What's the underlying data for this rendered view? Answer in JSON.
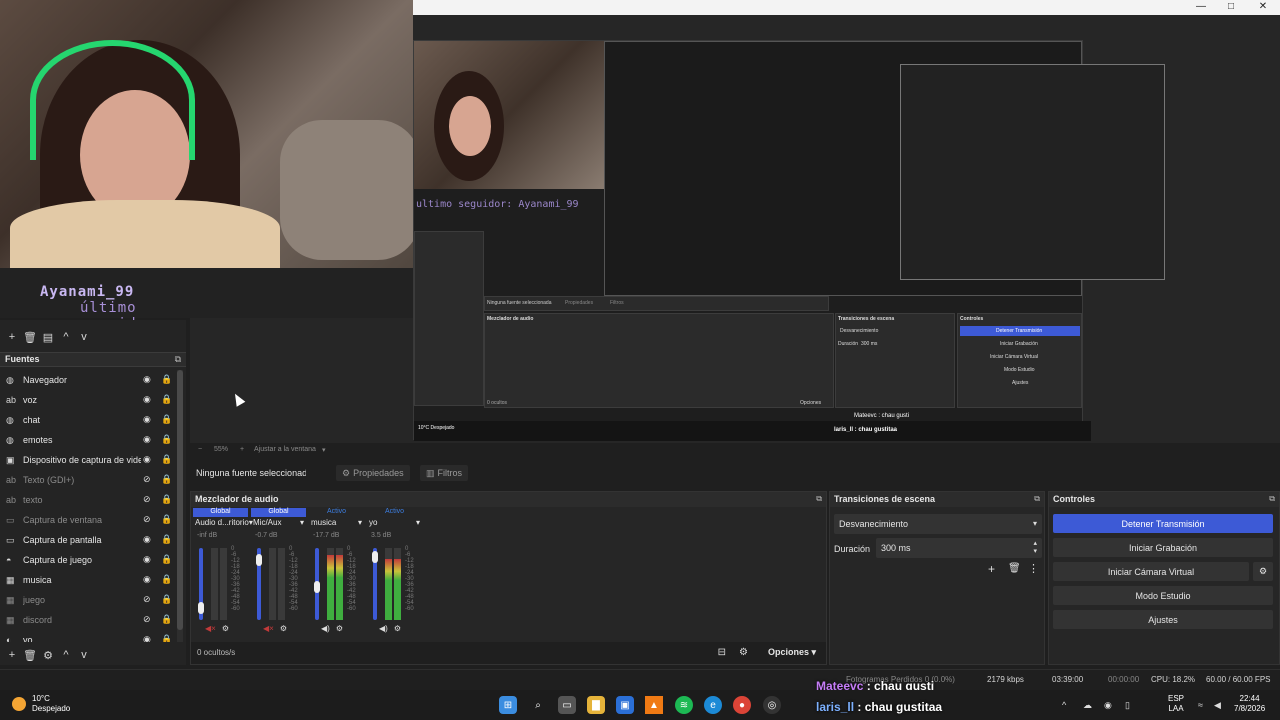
{
  "window": {
    "controls": [
      "—",
      "□",
      "✕"
    ]
  },
  "preview": {
    "follower_label": "último seguidor:",
    "follower_name": "Ayanami_99",
    "nested_follower": "ultimo seguidor: Ayanami_99",
    "nested_no_source": "Ninguna fuente seleccionada",
    "nested_mixer": "Mezclador de audio",
    "nested_transitions": "Transiciones de escena",
    "nested_controls": "Controles",
    "nested_stop": "Detener Transmisión",
    "nested_rec": "Iniciar Grabación",
    "nested_vcam": "Iniciar Cámara Virtual",
    "nested_studio": "Modo Estudio",
    "nested_settings": "Ajustes",
    "nested_fade": "Desvanecimiento",
    "nested_duration": "Duración",
    "nested_duration_val": "300 ms",
    "nested_props": "Propiedades",
    "nested_filters": "Filtros",
    "nested_options": "Opciones",
    "nested_chat1": "Mateevc : chau gusti",
    "nested_chat2": "laris_ll : chau gustitaa",
    "nested_hidden": "0 ocultos",
    "nested_weather": "10°C Despejado"
  },
  "zoom": {
    "value": "55%",
    "fit_label": "Ajustar a la ventana"
  },
  "sources_dock": {
    "title": "Fuentes",
    "items": [
      {
        "label": "Navegador",
        "icon": "globe-icon",
        "visible": true
      },
      {
        "label": "voz",
        "icon": "text-icon",
        "visible": true
      },
      {
        "label": "chat",
        "icon": "globe-icon",
        "visible": true
      },
      {
        "label": "emotes",
        "icon": "globe-icon",
        "visible": true
      },
      {
        "label": "Dispositivo de captura de vide",
        "icon": "camera-icon",
        "visible": true
      },
      {
        "label": "Texto (GDI+)",
        "icon": "text-icon",
        "visible": false
      },
      {
        "label": "texto",
        "icon": "text-icon",
        "visible": false
      },
      {
        "label": "Captura de ventana",
        "icon": "window-icon",
        "visible": false
      },
      {
        "label": "Captura de pantalla",
        "icon": "monitor-icon",
        "visible": true
      },
      {
        "label": "Captura de juego",
        "icon": "gamepad-icon",
        "visible": true
      },
      {
        "label": "musica",
        "icon": "audio-icon",
        "visible": true
      },
      {
        "label": "juego",
        "icon": "audio-icon",
        "visible": false
      },
      {
        "label": "discord",
        "icon": "audio-icon",
        "visible": false
      },
      {
        "label": "yo",
        "icon": "mic-icon",
        "visible": true
      }
    ]
  },
  "properties_bar": {
    "no_source": "Ninguna fuente seleccionada",
    "properties": "Propiedades",
    "filters": "Filtros"
  },
  "mixer": {
    "title": "Mezclador de audio",
    "channels": [
      {
        "status": "Global",
        "name": "Audio d...ritorio",
        "db": "-inf dB",
        "level": 0.0,
        "fader": 0.1
      },
      {
        "status": "Global",
        "name": "Mic/Aux",
        "db": "-0.7 dB",
        "level": 0.0,
        "fader": 0.9
      },
      {
        "status": "Activo",
        "name": "musica",
        "db": "-17.7 dB",
        "level": 0.9,
        "fader": 0.45
      },
      {
        "status": "Activo",
        "name": "yo",
        "db": "3.5 dB",
        "level": 0.85,
        "fader": 0.95
      }
    ],
    "ticks": [
      "0",
      "-6",
      "-12",
      "-18",
      "-24",
      "-30",
      "-36",
      "-42",
      "-48",
      "-54",
      "-60"
    ],
    "hidden_count": "0 ocultos/s",
    "options": "Opciones"
  },
  "transitions": {
    "title": "Transiciones de escena",
    "selected": "Desvanecimiento",
    "duration_label": "Duración",
    "duration_value": "300 ms"
  },
  "controls": {
    "title": "Controles",
    "stop_stream": "Detener Transmisión",
    "start_recording": "Iniciar Grabación",
    "start_virtual_cam": "Iniciar Cámara Virtual",
    "studio_mode": "Modo Estudio",
    "settings": "Ajustes"
  },
  "status_bar": {
    "dropped_frames": "Fotogramas Perdidos 0 (0.0%)",
    "bitrate": "2179 kbps",
    "stream_time": "03:39:00",
    "rec_time": "00:00:00",
    "cpu": "CPU: 18.2%",
    "fps": "60.00 / 60.00 FPS"
  },
  "chat": {
    "line1_user": "Mateevc",
    "line1_msg": " : chau gusti",
    "line2_user": "laris_ll",
    "line2_msg": " : chau gustitaa"
  },
  "taskbar": {
    "weather_temp": "10°C",
    "weather_desc": "Despejado",
    "lang_top": "ESP",
    "lang_bottom": "LAA",
    "time": "22:44",
    "date": "7/8/2026"
  },
  "colors": {
    "accent": "#3d5ad6",
    "headset": "#25d66f",
    "follower_text": "#a78fd6"
  }
}
